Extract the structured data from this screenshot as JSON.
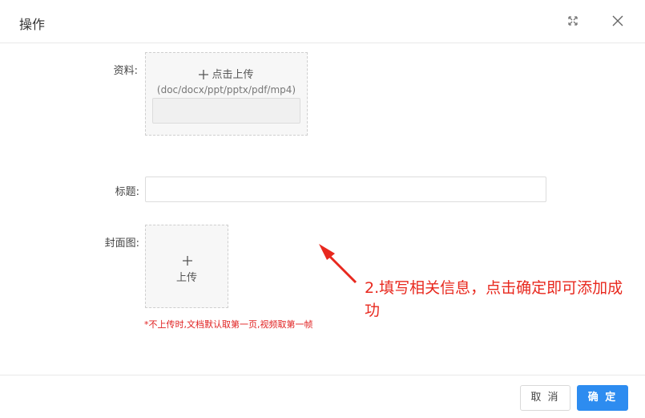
{
  "dialog": {
    "title": "操作"
  },
  "form": {
    "file_label": "资料:",
    "file_upload_text": "点击上传",
    "file_hint": "(doc/docx/ppt/pptx/pdf/mp4)",
    "title_label": "标题:",
    "title_value": "",
    "title_placeholder": "",
    "cover_label": "封面图:",
    "cover_upload_text": "上传",
    "cover_note": "*不上传时,文档默认取第一页,视频取第一帧"
  },
  "annotation": {
    "text": "2.填写相关信息，点击确定即可添加成功",
    "color": "#e8281e"
  },
  "footer": {
    "cancel_label": "取 消",
    "ok_label": "确 定"
  },
  "icons": {
    "fullscreen": "fullscreen-icon",
    "close": "close-icon",
    "plus": "plus-icon"
  },
  "colors": {
    "primary": "#2d8cf0",
    "danger": "#e02020"
  }
}
